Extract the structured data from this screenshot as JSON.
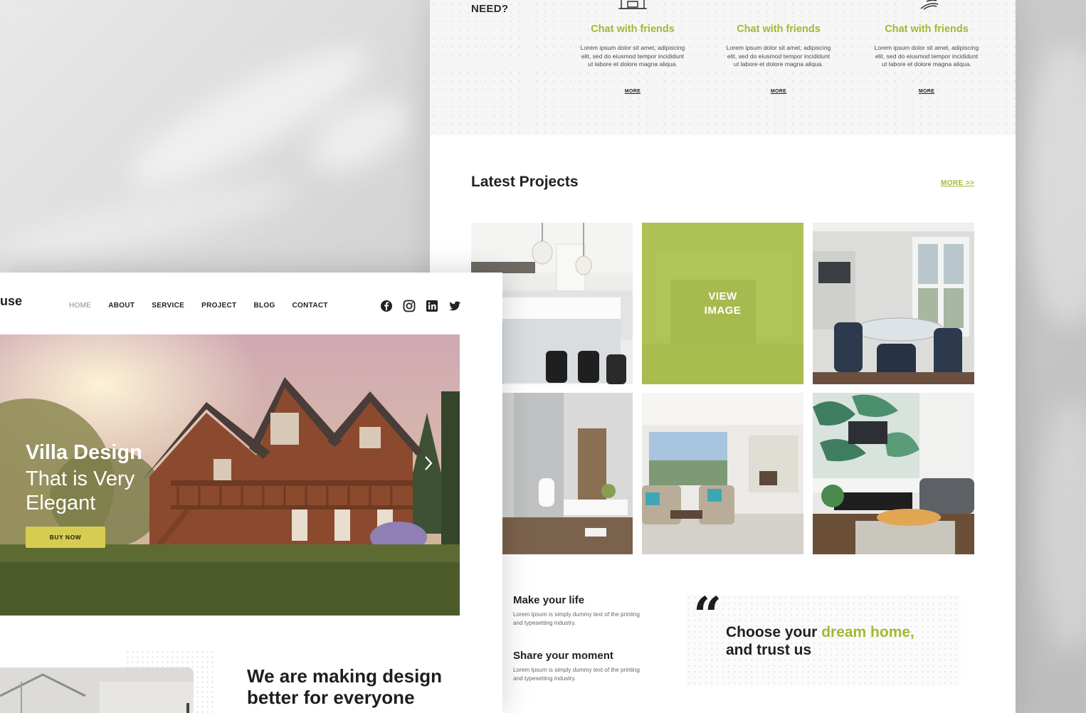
{
  "features": {
    "heading_fragment": "NEED?",
    "items": [
      {
        "title": "Chat with friends",
        "text": "Lorem ipsum dolor sit amet, adipiscing elit, sed do eiusmod tempor incididunt ut labore et dolore magna aliqua.",
        "more": "MORE"
      },
      {
        "title": "Chat with friends",
        "text": "Lorem ipsum dolor sit amet, adipiscing elit, sed do eiusmod tempor incididunt ut labore et dolore magna aliqua.",
        "more": "MORE"
      },
      {
        "title": "Chat with friends",
        "text": "Lorem ipsum dolor sit amet, adipiscing elit, sed do eiusmod tempor incididunt ut labore et dolore magna aliqua.",
        "more": "MORE"
      }
    ]
  },
  "projects": {
    "title": "Latest Projects",
    "more": "MORE >>",
    "overlay_label": "VIEW IMAGE"
  },
  "life": [
    {
      "title": "Make your life",
      "text": "Lorem Ipsum is simply dummy text of the printing and typesetting industry."
    },
    {
      "title": "Share your moment",
      "text": "Lorem Ipsum is simply dummy text of the printing and typesetting industry."
    }
  ],
  "quote": {
    "mark": "“",
    "before": "Choose your ",
    "accent": "dream home,",
    "after": "and trust us"
  },
  "front": {
    "logo_fragment": "use",
    "nav": [
      "HOME",
      "ABOUT",
      "SERVICE",
      "PROJECT",
      "BLOG",
      "CONTACT"
    ],
    "hero": {
      "title_bold": "Villa Design",
      "title_light": "That is Very Elegant",
      "button": "BUY NOW"
    },
    "about_title": "We are making design better for everyone"
  },
  "colors": {
    "accent": "#a5b733",
    "button": "#d7cc52",
    "text": "#1e1e1e"
  },
  "icons": {
    "social": [
      "facebook-icon",
      "instagram-icon",
      "linkedin-icon",
      "twitter-icon"
    ],
    "hero_next": "chevron-right-icon"
  }
}
